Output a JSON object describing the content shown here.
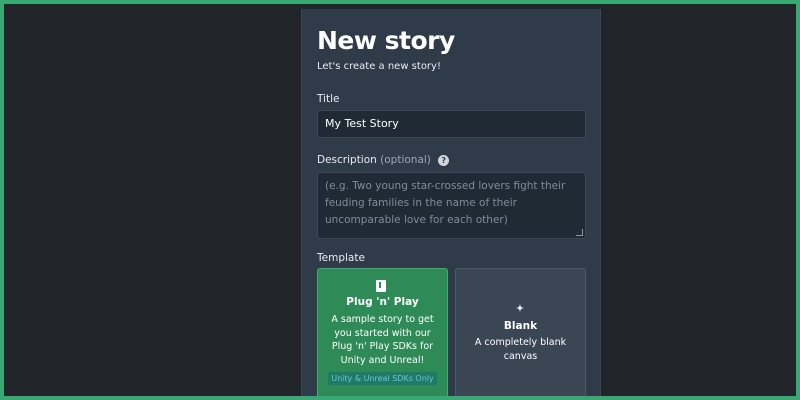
{
  "page": {
    "title": "New story",
    "subtitle": "Let's create a new story!"
  },
  "form": {
    "title_label": "Title",
    "title_value": "My Test Story",
    "description_label": "Description",
    "description_optional": "(optional)",
    "description_placeholder": "(e.g. Two young star-crossed lovers fight their feuding families in the name of their uncomparable love for each other)",
    "template_label": "Template"
  },
  "templates": [
    {
      "name": "Plug 'n' Play",
      "description": "A sample story to get you started with our Plug 'n' Play SDKs for Unity and Unreal!",
      "badge": "Unity & Unreal SDKs Only",
      "icon": "book-icon",
      "selected": true
    },
    {
      "name": "Blank",
      "description": "A completely blank canvas",
      "icon": "sparkle-icon",
      "selected": false
    }
  ],
  "colors": {
    "outer_border": "#3aa873",
    "background": "#212529",
    "panel": "#2f3b48",
    "selected_card": "#2e8b57",
    "unselected_card": "#3a4653"
  }
}
